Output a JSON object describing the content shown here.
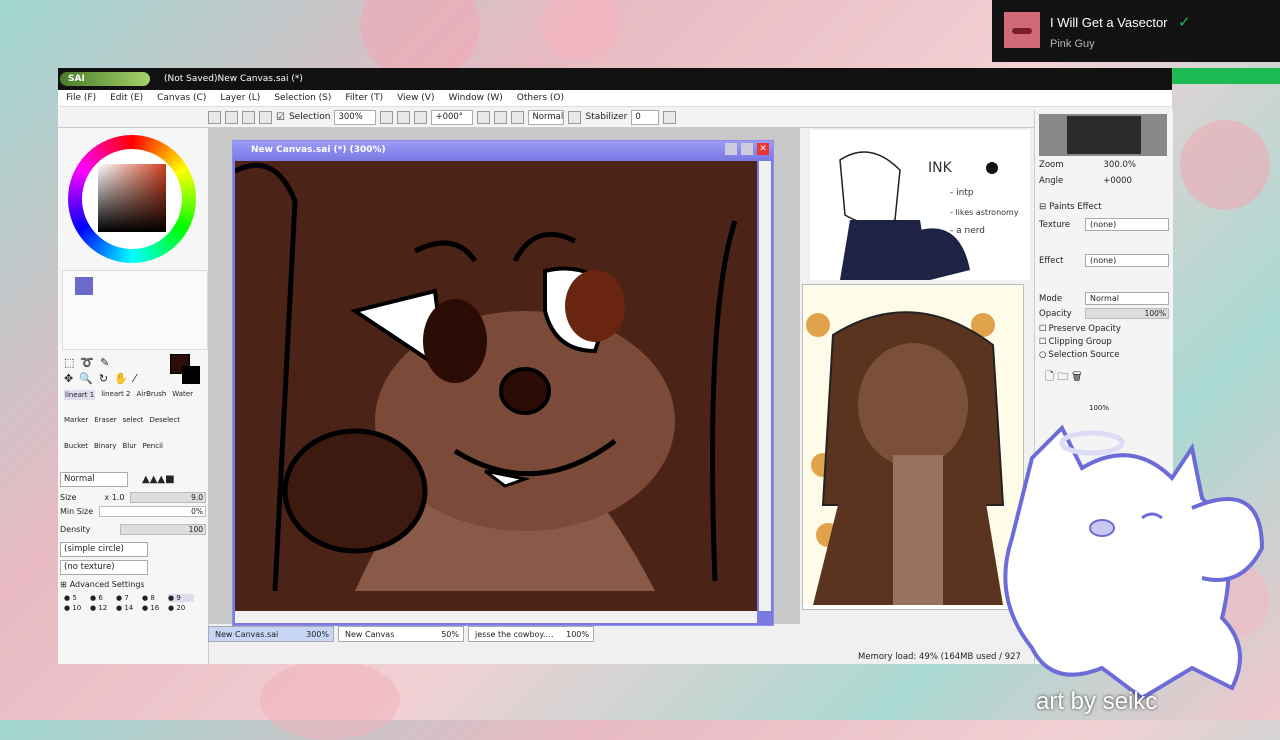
{
  "notification": {
    "song_title": "I Will Get a Vasector",
    "artist": "Pink Guy"
  },
  "window": {
    "title": "(Not Saved)New Canvas.sai (*)",
    "logo_text": "SAI"
  },
  "menu": [
    "File (F)",
    "Edit (E)",
    "Canvas (C)",
    "Layer (L)",
    "Selection (S)",
    "Filter (T)",
    "View (V)",
    "Window (W)",
    "Others (O)"
  ],
  "toolbar": {
    "selection_label": "Selection",
    "zoom": "300%",
    "angle": "+000°",
    "blend": "Normal",
    "stabilizer_label": "Stabilizer",
    "stabilizer_value": "0"
  },
  "document": {
    "title": "New Canvas.sai (*) (300%)"
  },
  "tools": {
    "row1": [
      "lineart 1",
      "lineart 2",
      "AirBrush",
      "Water"
    ],
    "row2": [
      "Marker",
      "Eraser",
      "select",
      "Deselect"
    ],
    "row3": [
      "Bucket",
      "Binary",
      "Blur",
      "Pencil"
    ]
  },
  "brush": {
    "mode": "Normal",
    "size_label": "Size",
    "size_mult": "x 1.0",
    "size_value": "9.0",
    "minsize_label": "Min Size",
    "minsize_value": "0%",
    "density_label": "Density",
    "density_value": "100",
    "shape": "(simple circle)",
    "texture": "(no texture)",
    "advanced": "Advanced Settings"
  },
  "brush_sizes": [
    "5",
    "6",
    "7",
    "8",
    "9",
    "10",
    "12",
    "14",
    "16",
    "20"
  ],
  "navigator": {
    "zoom_label": "Zoom",
    "zoom_value": "300.0%",
    "angle_label": "Angle",
    "angle_value": "+0000"
  },
  "paints_effect": {
    "header": "Paints Effect",
    "texture_label": "Texture",
    "texture_value": "(none)",
    "effect_label": "Effect",
    "effect_value": "(none)"
  },
  "layer_props": {
    "mode_label": "Mode",
    "mode_value": "Normal",
    "opacity_label": "Opacity",
    "opacity_value": "100%",
    "preserve": "Preserve Opacity",
    "clipping": "Clipping Group",
    "selsource": "Selection Source",
    "layer_opacity": "100%"
  },
  "ref_text": {
    "ink": "INK",
    "l1": "- intp",
    "l2": "- likes astronomy",
    "l3": "- a nerd"
  },
  "tabs": [
    {
      "name": "New Canvas.sai",
      "zoom": "300%"
    },
    {
      "name": "New Canvas",
      "zoom": "50%"
    },
    {
      "name": "jesse the cowboy.…",
      "zoom": "100%"
    }
  ],
  "status": "Memory load: 49% (164MB used / 927",
  "watermark": "art by seikc",
  "colors": {
    "accent": "#7b7be6",
    "spotify_green": "#1db954",
    "canvas_bg": "#4b2417"
  }
}
